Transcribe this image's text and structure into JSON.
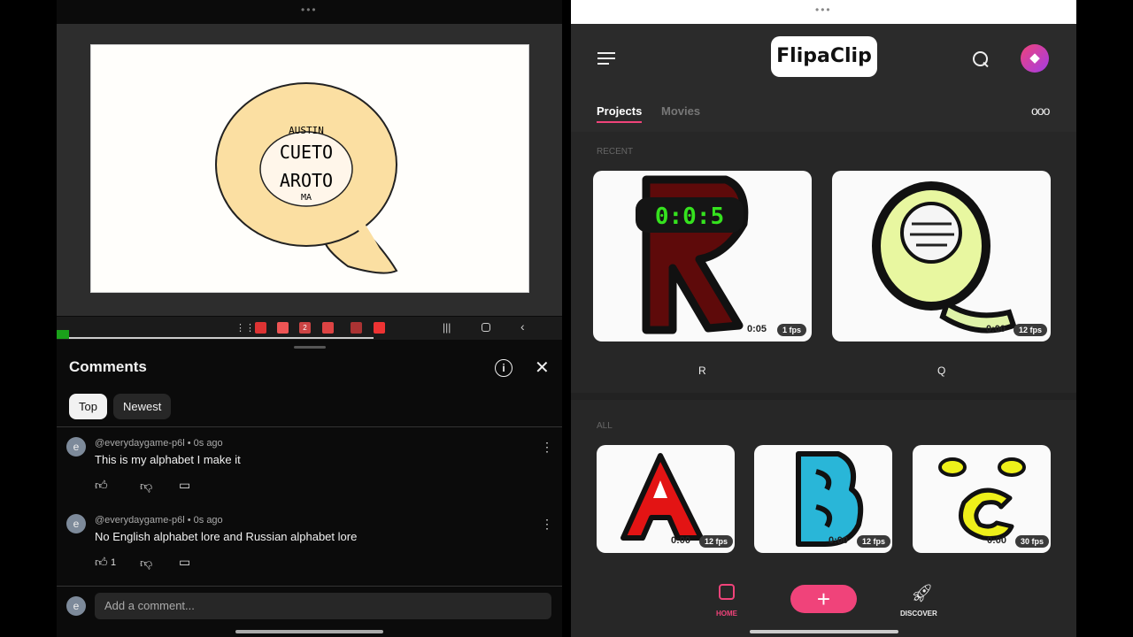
{
  "left": {
    "video": {
      "nav_badge": "2"
    },
    "comments": {
      "title": "Comments",
      "chips": [
        "Top",
        "Newest"
      ],
      "items": [
        {
          "avatar": "e",
          "author": "@everydaygame-p6l",
          "time": "• 0s ago",
          "text": "This is my alphabet I make it",
          "likes": ""
        },
        {
          "avatar": "e",
          "author": "@everydaygame-p6l",
          "time": "• 0s ago",
          "text": "No English alphabet lore and Russian alphabet lore",
          "likes": "1"
        }
      ],
      "add_placeholder": "Add a comment...",
      "add_avatar": "e"
    },
    "drawing_text": [
      "AUSTIN",
      "CUETO",
      "AROTO",
      "MA"
    ]
  },
  "right": {
    "logo": "FlipaClip",
    "tabs": [
      "Projects",
      "Movies"
    ],
    "recent_label": "RECENT",
    "all_label": "ALL",
    "recent": [
      {
        "title": "R",
        "duration": "0:05",
        "fps": "1 fps",
        "overlay": "0:0:5"
      },
      {
        "title": "Q",
        "duration": "0:00",
        "fps": "12 fps"
      }
    ],
    "all": [
      {
        "duration": "0:00",
        "fps": "12 fps"
      },
      {
        "duration": "0:00",
        "fps": "12 fps"
      },
      {
        "duration": "0:00",
        "fps": "30 fps"
      }
    ],
    "nav": {
      "home": "HOME",
      "discover": "DISCOVER",
      "add": "+"
    },
    "colors": {
      "accent": "#f0437a",
      "premium": "#c93ee0"
    }
  }
}
